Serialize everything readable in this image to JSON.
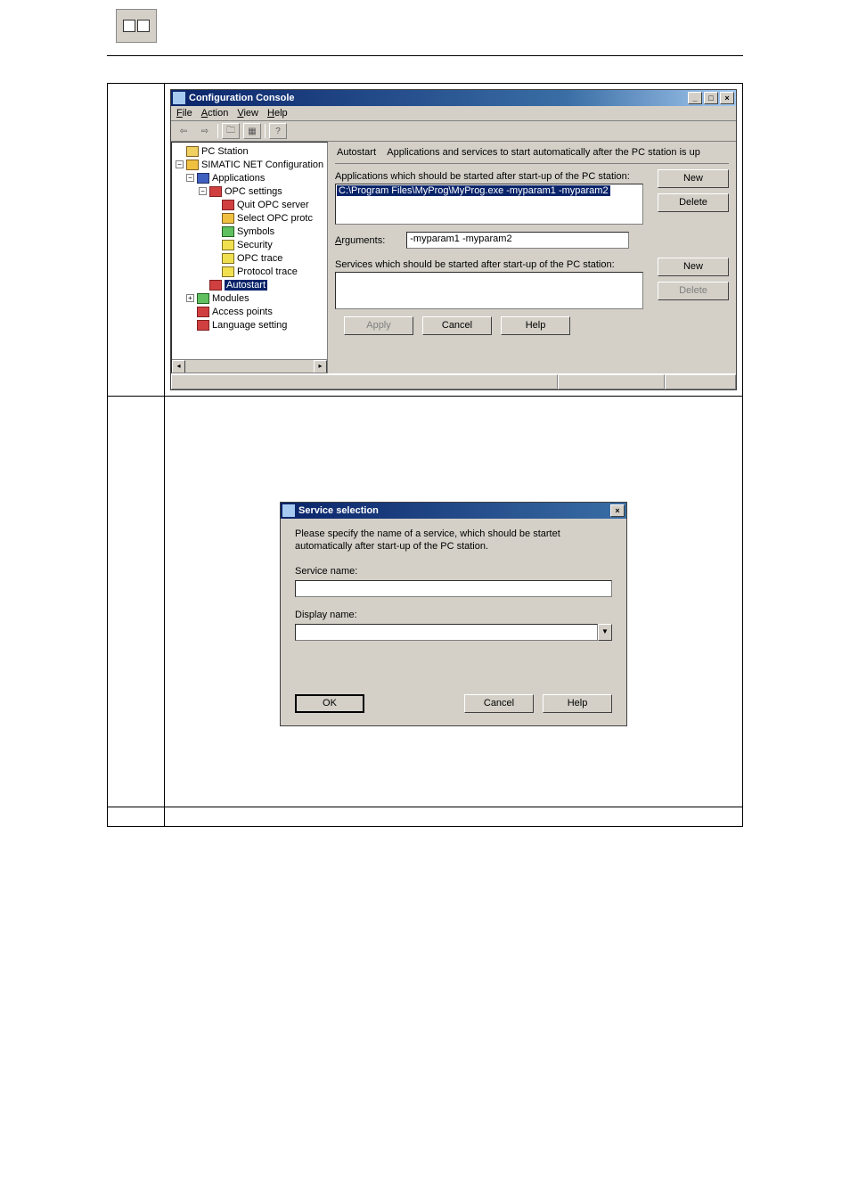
{
  "window": {
    "title": "Configuration Console",
    "menus": {
      "file": "File",
      "action": "Action",
      "view": "View",
      "help": "Help"
    },
    "tree": {
      "root": "PC Station",
      "n1": "SIMATIC NET Configuration",
      "n2": "Applications",
      "n3": "OPC settings",
      "leaves": {
        "quit_opc": "Quit OPC server",
        "select_opc": "Select OPC protc",
        "symbols": "Symbols",
        "security": "Security",
        "opc_trace": "OPC trace",
        "protocol_trace": "Protocol trace",
        "autostart": "Autostart"
      },
      "modules": "Modules",
      "access_points": "Access points",
      "language_setting": "Language setting"
    },
    "content": {
      "header_title": "Autostart",
      "header_desc": "Applications and services to start automatically after the PC station is up",
      "apps_label": "Applications which should be started after start-up of the PC station:",
      "app_item": "C:\\Program Files\\MyProg\\MyProg.exe -myparam1 -myparam2",
      "arguments_label": "Arguments:",
      "arguments_value": "-myparam1 -myparam2",
      "services_label": "Services which should be started after start-up of the PC station:",
      "buttons": {
        "new": "New",
        "delete": "Delete",
        "apply": "Apply",
        "cancel": "Cancel",
        "help": "Help"
      }
    }
  },
  "dialog": {
    "title": "Service selection",
    "prompt": "Please specify the name of a service, which should be startet automatically after start-up of the PC station.",
    "service_name_label": "Service name:",
    "display_name_label": "Display name:",
    "buttons": {
      "ok": "OK",
      "cancel": "Cancel",
      "help": "Help"
    }
  }
}
